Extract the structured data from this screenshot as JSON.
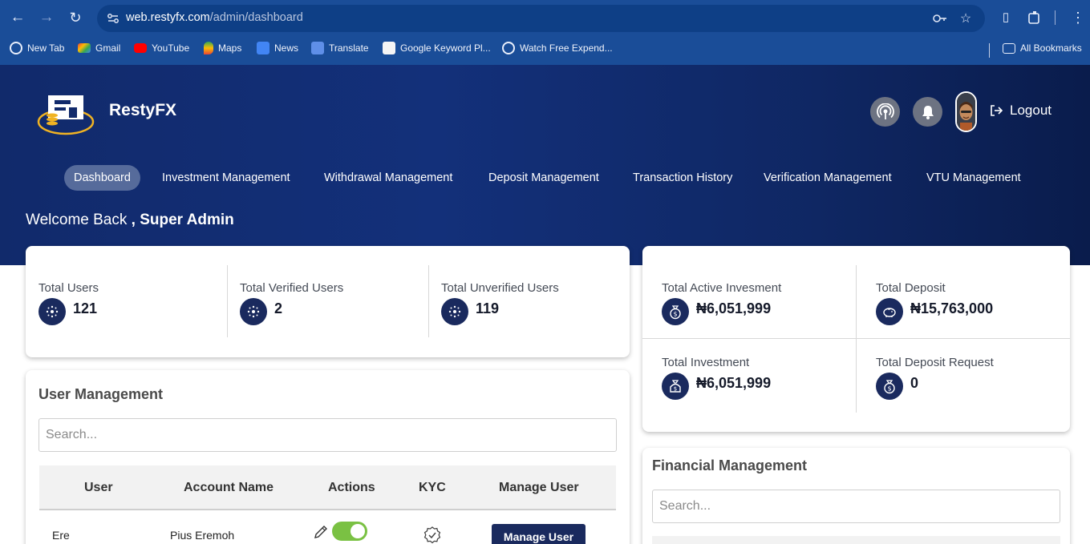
{
  "browser": {
    "url_host": "web.restyfx.com",
    "url_path": "/admin/dashboard",
    "bookmarks": [
      {
        "label": "New Tab",
        "icon": "globe-icon"
      },
      {
        "label": "Gmail",
        "icon": "gmail-icon"
      },
      {
        "label": "YouTube",
        "icon": "youtube-icon"
      },
      {
        "label": "Maps",
        "icon": "maps-icon"
      },
      {
        "label": "News",
        "icon": "news-icon"
      },
      {
        "label": "Translate",
        "icon": "translate-icon"
      },
      {
        "label": "Google Keyword Pl...",
        "icon": "seo-icon"
      },
      {
        "label": "Watch Free Expend...",
        "icon": "globe-icon"
      }
    ],
    "all_bookmarks": "All Bookmarks"
  },
  "app": {
    "brand": "RestyFX",
    "logout": "Logout",
    "nav": [
      {
        "label": "Dashboard",
        "active": true
      },
      {
        "label": "Investment Management"
      },
      {
        "label": "Withdrawal Management"
      },
      {
        "label": "Deposit Management"
      },
      {
        "label": "Transaction History"
      },
      {
        "label": "Verification Management"
      },
      {
        "label": "VTU Management"
      }
    ],
    "welcome_prefix": "Welcome Back",
    "welcome_name": ", Super Admin"
  },
  "user_stats": [
    {
      "label": "Total Users",
      "value": "121"
    },
    {
      "label": "Total Verified Users",
      "value": "2"
    },
    {
      "label": "Total Unverified Users",
      "value": "119"
    }
  ],
  "finance_stats": [
    {
      "label": "Total Active Invesment",
      "value": "₦6,051,999"
    },
    {
      "label": "Total Deposit",
      "value": "₦15,763,000"
    },
    {
      "label": "Total Investment",
      "value": "₦6,051,999"
    },
    {
      "label": "Total Deposit Request",
      "value": "0"
    }
  ],
  "user_management": {
    "title": "User Management",
    "search_placeholder": "Search...",
    "columns": [
      "User",
      "Account Name",
      "Actions",
      "KYC",
      "Manage User"
    ],
    "rows": [
      {
        "user": "Ere",
        "account_name": "Pius Eremoh",
        "enabled": true,
        "manage_label": "Manage User"
      }
    ]
  },
  "financial_management": {
    "title": "Financial Management",
    "search_placeholder": "Search..."
  },
  "colors": {
    "hero_start": "#112a6b",
    "hero_end": "#0a1c4c",
    "accent_navy": "#1a2a5e",
    "toggle_on": "#7ac143",
    "browser_blue": "#1a4d98"
  }
}
